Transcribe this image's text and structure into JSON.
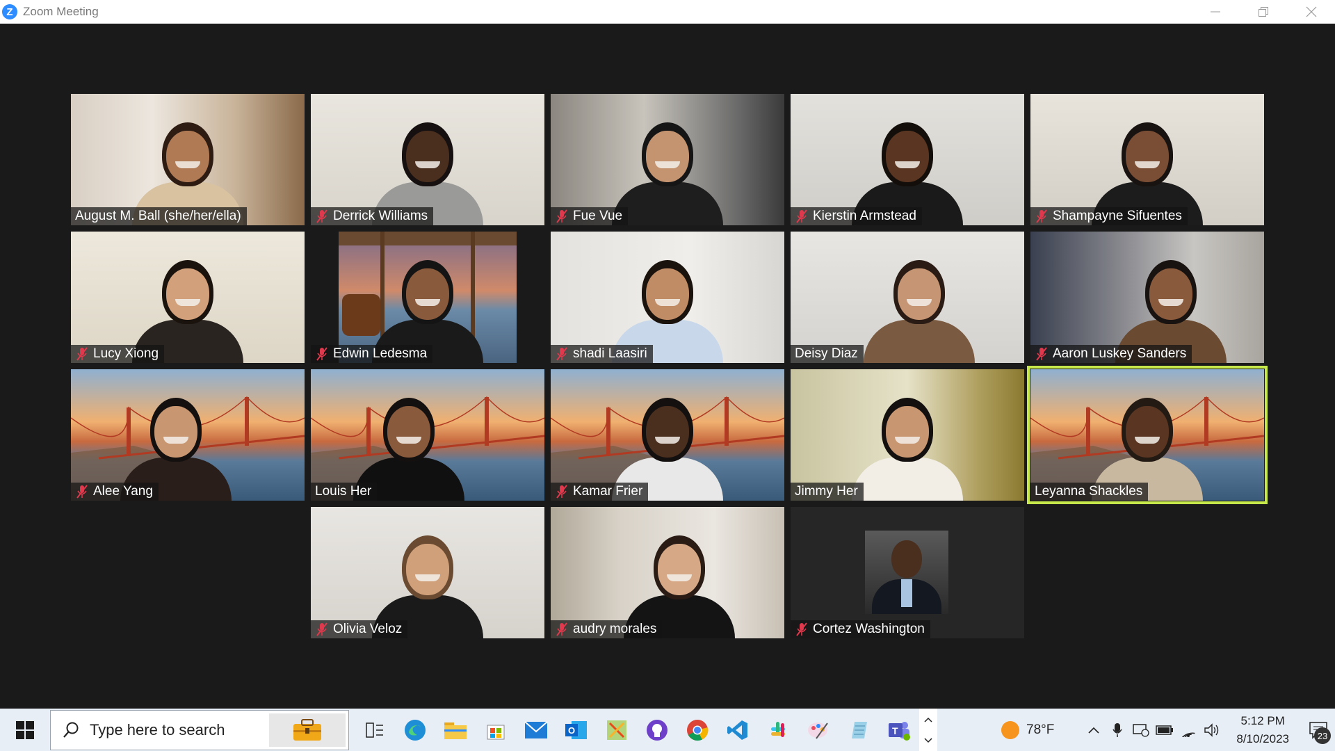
{
  "window": {
    "title": "Zoom Meeting",
    "logo_letter": "Z"
  },
  "participants": [
    {
      "name": "August M. Ball (she/her/ella)",
      "muted": false
    },
    {
      "name": "Derrick Williams",
      "muted": true
    },
    {
      "name": "Fue Vue",
      "muted": true
    },
    {
      "name": "Kierstin Armstead",
      "muted": true
    },
    {
      "name": "Shampayne Sifuentes",
      "muted": true
    },
    {
      "name": "Lucy Xiong",
      "muted": true
    },
    {
      "name": "Edwin Ledesma",
      "muted": true
    },
    {
      "name": "shadi Laasiri",
      "muted": true
    },
    {
      "name": "Deisy Diaz",
      "muted": false
    },
    {
      "name": "Aaron Luskey Sanders",
      "muted": true
    },
    {
      "name": "Alee Yang",
      "muted": true
    },
    {
      "name": "Louis Her",
      "muted": false
    },
    {
      "name": "Kamar Frier",
      "muted": true
    },
    {
      "name": "Jimmy Her",
      "muted": false
    },
    {
      "name": "Leyanna Shackles",
      "muted": false,
      "active_speaker": true
    },
    {
      "name": "Olivia Veloz",
      "muted": true
    },
    {
      "name": "audry morales",
      "muted": true
    },
    {
      "name": "Cortez Washington",
      "muted": true,
      "video_off": true
    }
  ],
  "taskbar": {
    "search_placeholder": "Type here to search",
    "apps": [
      "task-view",
      "edge",
      "file-explorer",
      "microsoft-store",
      "mail",
      "outlook",
      "snipping-tool",
      "github-desktop",
      "chrome",
      "vscode",
      "slack",
      "paint",
      "notepad",
      "teams"
    ],
    "weather_temp": "78°F",
    "time": "5:12 PM",
    "date": "8/10/2023",
    "notification_count": "23"
  },
  "colors": {
    "active_speaker_border": "#c6e84a",
    "mute_icon": "#e0384c",
    "meeting_bg": "#1a1a1a",
    "zoom_blue": "#2d8cff"
  }
}
